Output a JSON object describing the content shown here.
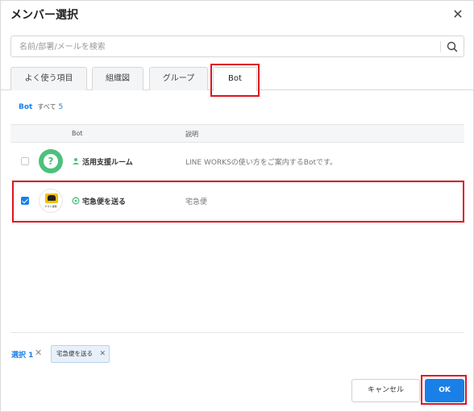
{
  "dialog": {
    "title": "メンバー選択",
    "close_icon": "close-icon"
  },
  "search": {
    "placeholder": "名前/部署/メールを検索",
    "icon": "search-icon"
  },
  "tabs": [
    {
      "label": "よく使う項目",
      "active": false
    },
    {
      "label": "組織図",
      "active": false
    },
    {
      "label": "グループ",
      "active": false
    },
    {
      "label": "Bot",
      "active": true
    }
  ],
  "breadcrumb": {
    "current": "Bot",
    "all_label": "すべて",
    "count": "5"
  },
  "table": {
    "columns": [
      "Bot",
      "説明"
    ],
    "rows": [
      {
        "checked": false,
        "avatar": "question-avatar-icon",
        "name_icon": "person-bot-icon",
        "name": "活用支援ルーム",
        "description": "LINE WORKSの使い方をご案内するBotです。"
      },
      {
        "checked": true,
        "avatar": "yamato-logo-icon",
        "avatar_text": "ヤマト運輸",
        "name_icon": "bot-circle-icon",
        "name": "宅急便を送る",
        "description": "宅急便"
      }
    ]
  },
  "selection": {
    "label": "選択",
    "count": "1",
    "chips": [
      {
        "label": "宅急便を送る"
      }
    ]
  },
  "buttons": {
    "cancel": "キャンセル",
    "ok": "OK"
  },
  "colors": {
    "accent": "#1a7fe6",
    "highlight": "#e0141e",
    "bot_green": "#4cc17c"
  }
}
